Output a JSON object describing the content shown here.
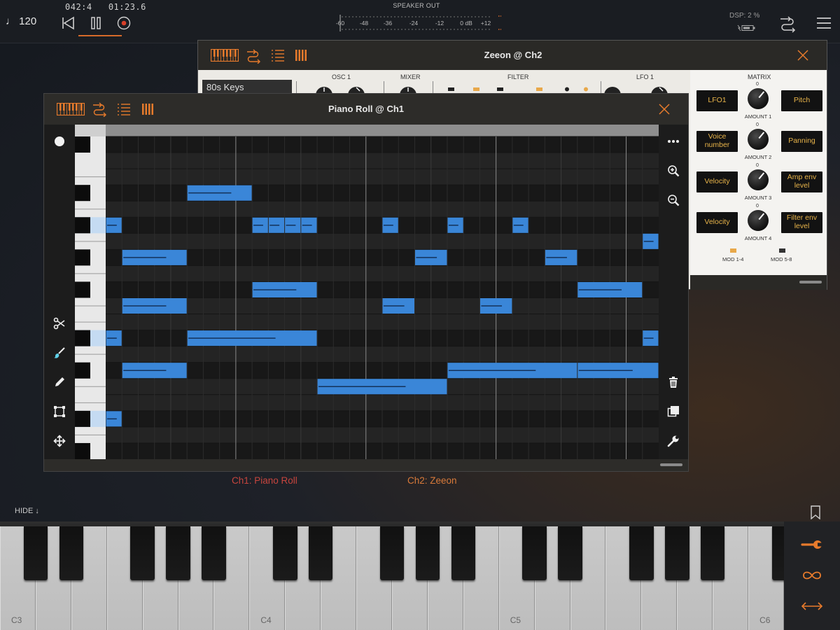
{
  "colors": {
    "accent": "#e87b2c",
    "note_fill": "#3a86d8",
    "note_line": "#14325a",
    "record": "#d8402a",
    "matrix_text": "#e8b44a",
    "ch1_label": "#c7453e",
    "ch2_label": "#d97a3a"
  },
  "transport": {
    "tempo": "♩ 120",
    "position": "042:4",
    "time": "01:23.6",
    "buttons": [
      "rewind-icon",
      "pause-icon",
      "record-icon"
    ]
  },
  "meter": {
    "title": "SPEAKER OUT",
    "ticks": [
      "-60",
      "-48",
      "-36",
      "-24",
      "-12",
      "0 dB",
      "+12"
    ]
  },
  "status": {
    "dsp": "DSP:  2 %"
  },
  "menu_icons": [
    "routing-icon",
    "hamburger-menu-icon"
  ],
  "zeeon": {
    "title": "Zeeon @ Ch2",
    "preset": "80s Keys",
    "sections": [
      "OSC 1",
      "MIXER",
      "FILTER",
      "LFO 1",
      "MATRIX"
    ],
    "matrix": {
      "rows": [
        {
          "source": "LFO1",
          "amount_label": "AMOUNT 1",
          "target": "Pitch"
        },
        {
          "source": "Voice number",
          "amount_label": "AMOUNT 2",
          "target": "Panning"
        },
        {
          "source": "Velocity",
          "amount_label": "AMOUNT 3",
          "target": "Amp env level"
        },
        {
          "source": "Velocity",
          "amount_label": "AMOUNT 4",
          "target": "Filter env level"
        }
      ],
      "knob_zero": "0",
      "mod_pages": [
        "MOD 1-4",
        "MOD 5-8"
      ],
      "active_mod_page": "MOD 1-4"
    }
  },
  "piano_roll": {
    "title": "Piano Roll @ Ch1",
    "header_icons": [
      "piano-keys-icon",
      "routing-icon",
      "list-icon",
      "bars-icon"
    ],
    "left_tools": [
      "record-dot-icon",
      "scissors-icon",
      "brush-icon",
      "pencil-icon",
      "select-box-icon",
      "move-icon"
    ],
    "right_tools": [
      "more-icon",
      "zoom-in-icon",
      "zoom-out-icon",
      "trash-icon",
      "duplicate-icon",
      "wrench-icon"
    ],
    "notes": [
      {
        "row": 3,
        "start": 5.0,
        "length": 4.0
      },
      {
        "row": 5,
        "start": 0.0,
        "length": 1.0
      },
      {
        "row": 5,
        "start": 9.0,
        "length": 1.0
      },
      {
        "row": 5,
        "start": 10.0,
        "length": 1.0
      },
      {
        "row": 5,
        "start": 11.0,
        "length": 1.0
      },
      {
        "row": 5,
        "start": 12.0,
        "length": 1.0
      },
      {
        "row": 5,
        "start": 17.0,
        "length": 1.0
      },
      {
        "row": 5,
        "start": 21.0,
        "length": 1.0
      },
      {
        "row": 5,
        "start": 25.0,
        "length": 1.0
      },
      {
        "row": 6,
        "start": 33.0,
        "length": 1.0
      },
      {
        "row": 7,
        "start": 1.0,
        "length": 4.0
      },
      {
        "row": 7,
        "start": 19.0,
        "length": 2.0
      },
      {
        "row": 7,
        "start": 27.0,
        "length": 2.0
      },
      {
        "row": 9,
        "start": 9.0,
        "length": 4.0
      },
      {
        "row": 9,
        "start": 29.0,
        "length": 4.0
      },
      {
        "row": 10,
        "start": 1.0,
        "length": 4.0
      },
      {
        "row": 10,
        "start": 17.0,
        "length": 2.0
      },
      {
        "row": 10,
        "start": 23.0,
        "length": 2.0
      },
      {
        "row": 12,
        "start": 0.0,
        "length": 1.0
      },
      {
        "row": 12,
        "start": 5.0,
        "length": 8.0
      },
      {
        "row": 12,
        "start": 33.0,
        "length": 1.0
      },
      {
        "row": 14,
        "start": 1.0,
        "length": 4.0
      },
      {
        "row": 14,
        "start": 21.0,
        "length": 8.0
      },
      {
        "row": 14,
        "start": 29.0,
        "length": 5.0
      },
      {
        "row": 15,
        "start": 13.0,
        "length": 8.0
      },
      {
        "row": 17,
        "start": 0.0,
        "length": 1.0
      }
    ]
  },
  "channels": [
    {
      "label": "Ch1: Piano Roll"
    },
    {
      "label": "Ch2: Zeeon"
    }
  ],
  "hide_label": "HIDE ↓",
  "keyboard": {
    "octave_labels": [
      "C3",
      "C4",
      "C5",
      "C6"
    ],
    "side_icons": [
      "wrench-icon",
      "infinity-icon",
      "horizontal-arrows-icon"
    ]
  }
}
